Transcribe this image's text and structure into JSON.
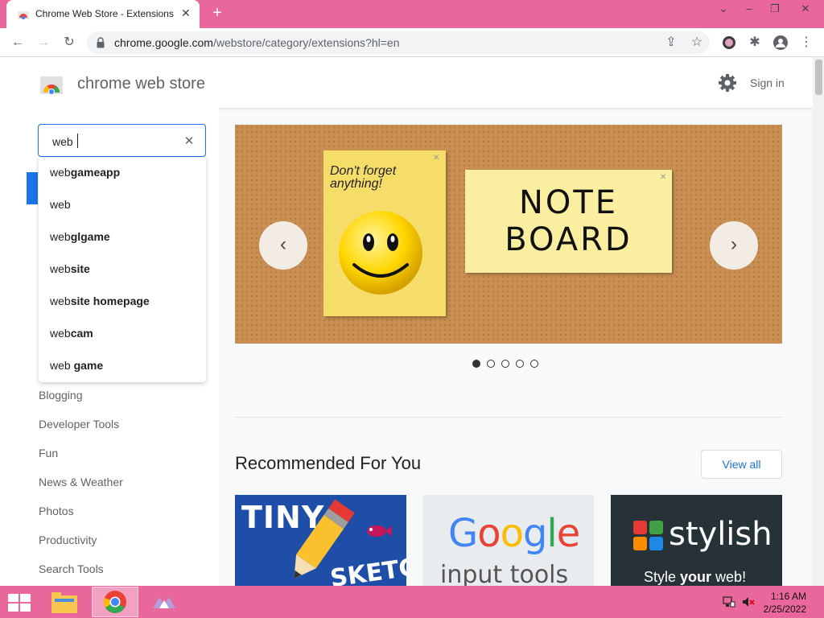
{
  "browser": {
    "tab_title": "Chrome Web Store - Extensions",
    "url_host": "chrome.google.com",
    "url_path": "/webstore/category/extensions?hl=en"
  },
  "store": {
    "name": "chrome web store",
    "signin_label": "Sign in"
  },
  "search": {
    "value": "web",
    "suggestions": [
      {
        "prefix": "web",
        "rest": "gameapp"
      },
      {
        "prefix": "web",
        "rest": ""
      },
      {
        "prefix": "web",
        "rest": "glgame"
      },
      {
        "prefix": "web",
        "rest": "site"
      },
      {
        "prefix": "web",
        "rest": "site homepage"
      },
      {
        "prefix": "web",
        "rest": "cam"
      },
      {
        "prefix": "web ",
        "rest": "game"
      }
    ]
  },
  "categories": [
    "Blogging",
    "Developer Tools",
    "Fun",
    "News & Weather",
    "Photos",
    "Productivity",
    "Search Tools"
  ],
  "carousel": {
    "note1": "Don't forget anything!",
    "note2_line1": "NOTE",
    "note2_line2": "BOARD",
    "slide_count": 5,
    "active_slide": 1
  },
  "recommended": {
    "title": "Recommended For You",
    "view_all": "View all",
    "cards": [
      {
        "line1": "TINY",
        "line2": "SKETCH"
      },
      {
        "line1": "Google",
        "line2": "input tools"
      },
      {
        "line1": "stylish",
        "line2_a": "Style ",
        "line2_b": "your",
        "line2_c": " web!"
      }
    ]
  },
  "taskbar": {
    "time": "1:16 AM",
    "date": "2/25/2022"
  },
  "colors": {
    "tabbar": "#e9679b",
    "accent": "#1a73e8",
    "cork": "#c98e52"
  }
}
